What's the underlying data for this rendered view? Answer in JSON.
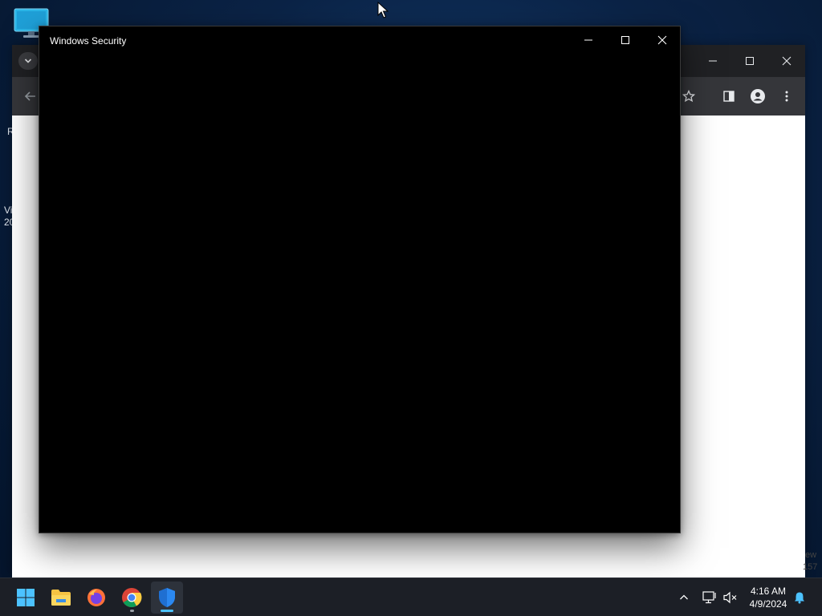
{
  "desktop": {
    "icons": [
      {
        "name": "This PC",
        "icon": "monitor-icon"
      }
    ],
    "clipped_label_fragments": [
      "R",
      "Vi",
      "20"
    ]
  },
  "background_window": {
    "app": "Google Chrome",
    "page_text_fragments": [
      "ew",
      "157"
    ],
    "toolbar_icons": [
      "back-arrow-icon",
      "bookmark-star-icon",
      "side-panel-icon",
      "profile-icon",
      "more-menu-icon"
    ],
    "window_controls": [
      "minimize",
      "maximize",
      "close"
    ]
  },
  "foreground_window": {
    "title": "Windows Security",
    "content": "",
    "controls": {
      "minimize": "minimize-icon",
      "maximize": "maximize-icon",
      "close": "close-icon"
    }
  },
  "taskbar": {
    "pinned": [
      {
        "name": "start",
        "icon": "windows-logo-icon",
        "running": false
      },
      {
        "name": "file-explorer",
        "icon": "folder-icon",
        "running": false
      },
      {
        "name": "firefox",
        "icon": "firefox-icon",
        "running": false
      },
      {
        "name": "chrome",
        "icon": "chrome-icon",
        "running": true
      },
      {
        "name": "windows-security",
        "icon": "shield-icon",
        "running": true,
        "active": true
      }
    ],
    "tray": {
      "icons": [
        "chevron-up-icon",
        "network-icon",
        "volume-muted-icon",
        "notification-bell-icon"
      ],
      "time": "4:16 AM",
      "date": "4/9/2024"
    }
  },
  "colors": {
    "desktop_bg": "#0b2346",
    "taskbar_bg": "#1c1f26",
    "security_window_bg": "#000000",
    "accent": "#4cc2ff"
  }
}
